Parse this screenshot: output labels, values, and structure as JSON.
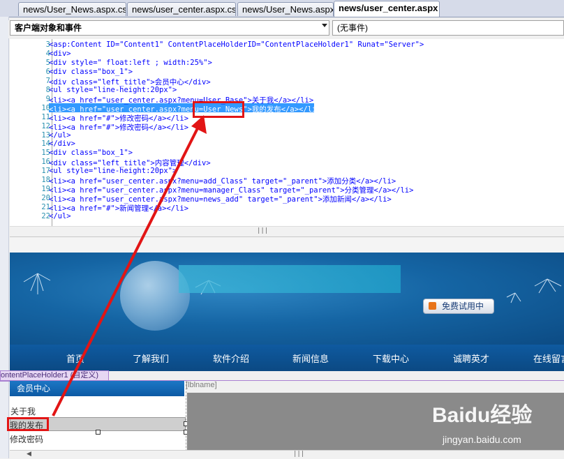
{
  "tabs": [
    {
      "label": "news/User_News.aspx.cs"
    },
    {
      "label": "news/user_center.aspx.cs"
    },
    {
      "label": "news/User_News.aspx"
    },
    {
      "label": "news/user_center.aspx"
    }
  ],
  "toolbar": {
    "objects_combo": "客户端对象和事件",
    "events_combo": "(无事件)"
  },
  "code_lines": [
    {
      "n": "3",
      "text": "<asp:Content ID=\"Content1\" ContentPlaceHolderID=\"ContentPlaceHolder1\" Runat=\"Server\">"
    },
    {
      "n": "4",
      "text": "<div>"
    },
    {
      "n": "5",
      "text": "<div style=\" float:left ; width:25%\">"
    },
    {
      "n": "6",
      "text": "<div class=\"box_1\">"
    },
    {
      "n": "7",
      "text": "<div class=\"left_title\">会员中心</div>"
    },
    {
      "n": "8",
      "text": "<ul style=\"line-height:20px\">"
    },
    {
      "n": "9",
      "text": "<li><a href=\"user_center.aspx?menu=User_Base\">关于我</a></li>"
    },
    {
      "n": "10",
      "text": "<li><a href=\"user_center.aspx?menu=User_News\">我的发布</a></li>"
    },
    {
      "n": "11",
      "text": "<li><a href=\"#\">修改密码</a></li>"
    },
    {
      "n": "12",
      "text": "<li><a href=\"#\">修改密码</a></li>"
    },
    {
      "n": "13",
      "text": "</ul>"
    },
    {
      "n": "14",
      "text": "</div>"
    },
    {
      "n": "15",
      "text": "<div class=\"box_1\">"
    },
    {
      "n": "16",
      "text": "<div class=\"left_title\">内容管理</div>"
    },
    {
      "n": "17",
      "text": "<ul style=\"line-height:20px\">"
    },
    {
      "n": "18",
      "text": "<li><a href=\"user_center.aspx?menu=add_Class\" target=\"_parent\">添加分类</a></li>"
    },
    {
      "n": "19",
      "text": "<li><a href=\"user_center.aspx?menu=manager_Class\" target=\"_parent\">分类管理</a></li>"
    },
    {
      "n": "20",
      "text": "<li><a href=\"user_center.aspx?menu=news_add\" target=\"_parent\">添加新闻</a></li>"
    },
    {
      "n": "21",
      "text": "<li><a href=\"#\">新闻管理</a></li>"
    },
    {
      "n": "22",
      "text": "</ul>"
    }
  ],
  "design": {
    "trial_button": "免费试用中",
    "nav": [
      "首页",
      "了解我们",
      "软件介绍",
      "新闻信息",
      "下载中心",
      "诚聘英才",
      "在线留言"
    ],
    "placeholder_label": "ontentPlaceHolder1 (自定义)",
    "box_title": "会员中心",
    "menu": [
      "关于我",
      "我的发布",
      "修改密码"
    ],
    "lbl_placeholder": "[lblname]"
  },
  "watermark": {
    "brand": "Baidu经验",
    "url": "jingyan.baidu.com"
  },
  "colors": {
    "annotation_red": "#e21515",
    "selection_blue": "#3399ff",
    "nav_blue": "#0b4983"
  }
}
